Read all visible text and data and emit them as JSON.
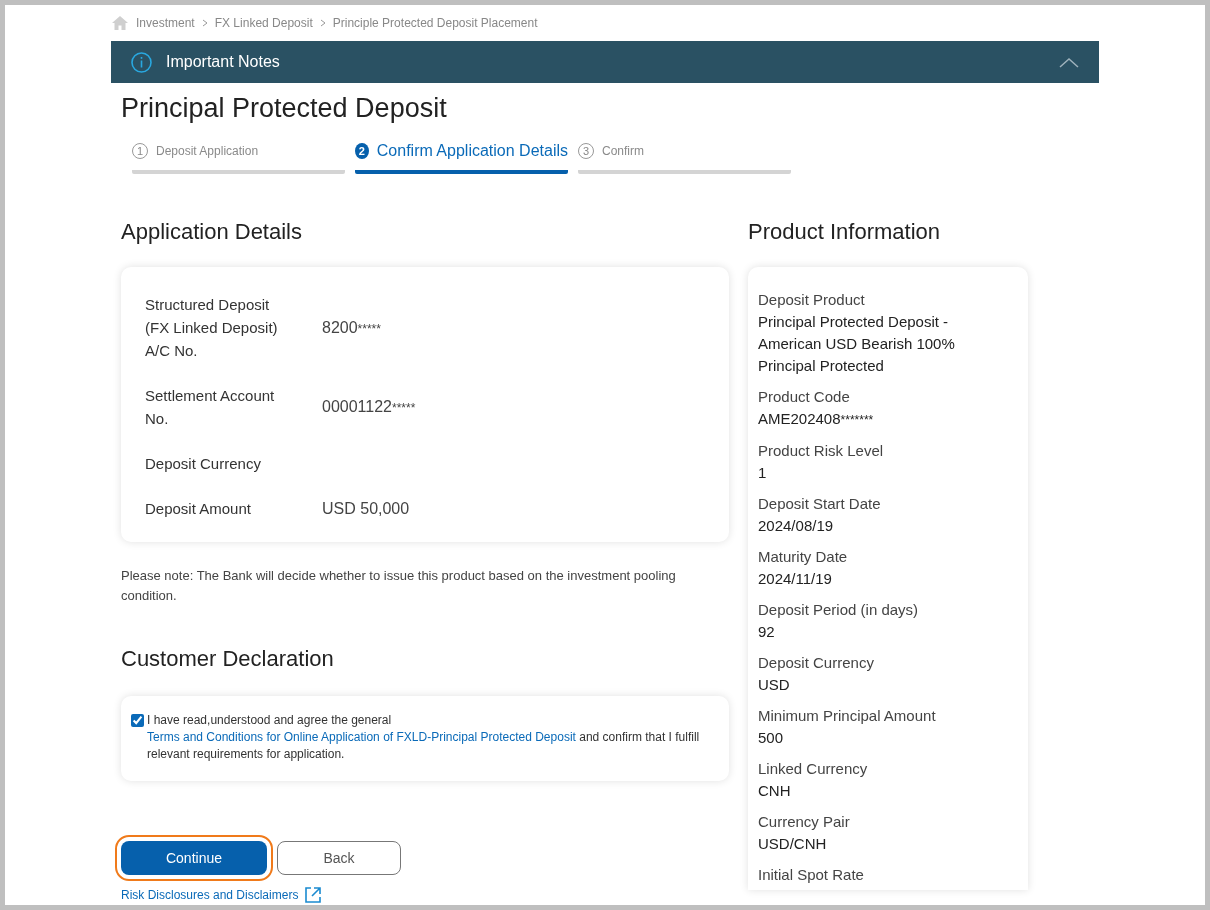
{
  "breadcrumb": [
    "Investment",
    "FX Linked Deposit",
    "Principle Protected Deposit Placement"
  ],
  "notes_bar": {
    "title": "Important Notes",
    "expanded": true
  },
  "page_title": "Principal Protected Deposit",
  "steps": [
    {
      "number": "1",
      "label": "Deposit Application",
      "selected": false
    },
    {
      "number": "2",
      "label": "Confirm Application Details",
      "selected": true
    },
    {
      "number": "3",
      "label": "Confirm",
      "selected": false
    }
  ],
  "application_details": {
    "title": "Application Details",
    "rows": [
      {
        "label": "Structured Deposit (FX Linked Deposit) A/C No.",
        "value": "8200",
        "mask": "*****"
      },
      {
        "label": "Settlement Account No.",
        "value": "00001122",
        "mask": "*****"
      },
      {
        "label": "Deposit Currency"
      },
      {
        "label": "Deposit Amount",
        "value": "USD 50,000"
      }
    ]
  },
  "note": "Please note: The Bank will decide whether to issue this product based on the investment pooling condition.",
  "declaration": {
    "title": "Customer Declaration",
    "checked": true,
    "text_before": "I have read,understood and agree the general",
    "link": "Terms and Conditions for Online Application of FXLD-Principal Protected Deposit",
    "text_after": "and confirm that I fulfill relevant requirements for application."
  },
  "buttons": [
    {
      "label": "Continue",
      "kind": "primary",
      "highlighted": true
    },
    {
      "label": "Back",
      "kind": "secondary",
      "highlighted": false
    }
  ],
  "risk_link": "Risk Disclosures and Disclaimers",
  "product_information": {
    "title": "Product Information",
    "items": [
      {
        "label": "Deposit Product",
        "value": "Principal Protected Deposit - American USD Bearish 100% Principal Protected"
      },
      {
        "label": "Product Code",
        "value": "AME202408",
        "mask": "*******"
      },
      {
        "label": "Product Risk Level",
        "value": "1"
      },
      {
        "label": "Deposit Start Date",
        "value": "2024/08/19"
      },
      {
        "label": "Maturity Date",
        "value": "2024/11/19"
      },
      {
        "label": "Deposit Period (in days)",
        "value": "92"
      },
      {
        "label": "Deposit Currency",
        "value": "USD"
      },
      {
        "label": "Minimum Principal Amount",
        "value": "500"
      },
      {
        "label": "Linked Currency",
        "value": "CNH"
      },
      {
        "label": "Currency Pair",
        "value": "USD/CNH"
      },
      {
        "label": "Initial Spot Rate"
      }
    ]
  }
}
